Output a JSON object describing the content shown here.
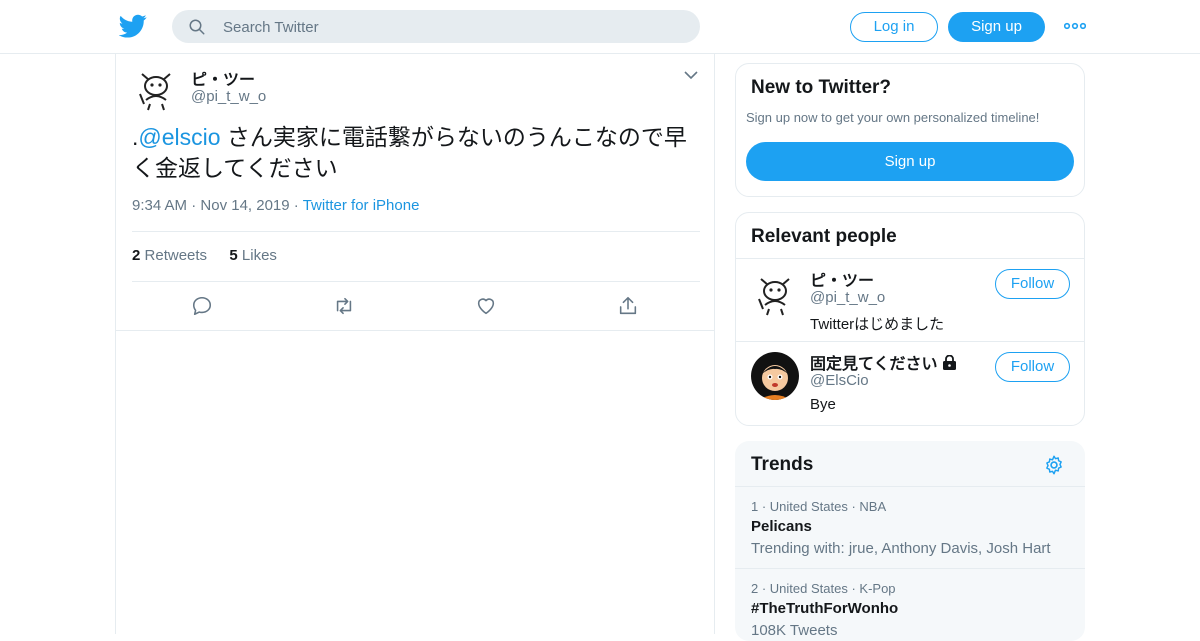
{
  "colors": {
    "accent": "#1da1f2",
    "link": "#1b95e0",
    "muted": "#657786",
    "text": "#14171a",
    "border": "#e6ecf0"
  },
  "header": {
    "logo_icon": "twitter-bird-icon",
    "search_placeholder": "Search Twitter",
    "login_label": "Log in",
    "signup_label": "Sign up",
    "more_icon": "more-dots-icon"
  },
  "tweet": {
    "name": "ピ・ツー",
    "handle": "@pi_t_w_o",
    "text_prefix": ".",
    "mention": "@elscio",
    "text_rest": " さん実家に電話繋がらないのうんこなので早く金返してください",
    "time": "9:34 AM",
    "date": "Nov 14, 2019",
    "source": "Twitter for iPhone",
    "retweet_count": "2",
    "retweet_label": "Retweets",
    "like_count": "5",
    "like_label": "Likes"
  },
  "sidebar": {
    "new_to_twitter": {
      "title": "New to Twitter?",
      "subtitle": "Sign up now to get your own personalized timeline!",
      "signup_label": "Sign up"
    },
    "relevant_people": {
      "title": "Relevant people",
      "people": [
        {
          "name": "ピ・ツー",
          "handle": "@pi_t_w_o",
          "bio": "Twitterはじめました",
          "follow_label": "Follow",
          "protected": false
        },
        {
          "name": "固定見てください",
          "handle": "@ElsCio",
          "bio": "Bye",
          "follow_label": "Follow",
          "protected": true
        }
      ]
    },
    "trends": {
      "title": "Trends",
      "items": [
        {
          "rank": "1",
          "location": "United States",
          "category": "NBA",
          "name": "Pelicans",
          "desc": "Trending with: jrue, Anthony Davis, Josh Hart"
        },
        {
          "rank": "2",
          "location": "United States",
          "category": "K-Pop",
          "name": "#TheTruthForWonho",
          "desc": "108K Tweets"
        }
      ]
    }
  }
}
